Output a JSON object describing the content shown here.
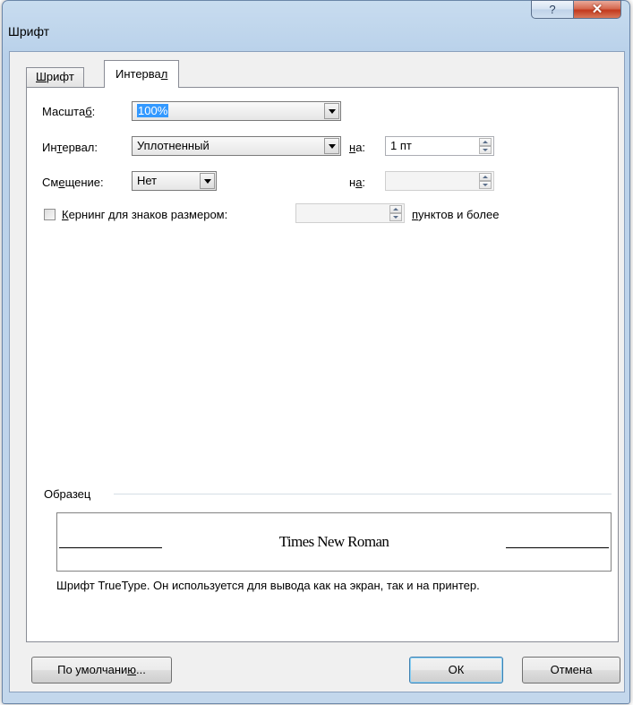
{
  "window": {
    "title": "Шрифт",
    "help_glyph": "?",
    "close_glyph": "✕"
  },
  "tabs": [
    {
      "pre": "",
      "mn": "Ш",
      "post": "рифт",
      "active": false
    },
    {
      "pre": "Интерва",
      "mn": "л",
      "post": "",
      "active": true
    }
  ],
  "scale": {
    "label_pre": "Масшта",
    "label_mn": "б",
    "label_post": ":",
    "value": "100%"
  },
  "spacing": {
    "label_pre": "Ин",
    "label_mn": "т",
    "label_post": "ервал:",
    "value": "Уплотненный",
    "by_mn": "н",
    "by_post": "а:",
    "by_value": "1 пт"
  },
  "position": {
    "label_pre": "См",
    "label_mn": "е",
    "label_post": "щение:",
    "value": "Нет",
    "by_pre": "н",
    "by_mn": "а",
    "by_post": ":",
    "by_value": ""
  },
  "kerning": {
    "checked": false,
    "label_mn": "К",
    "label_post": "ернинг для знаков размером:",
    "value": "",
    "suffix_mn": "п",
    "suffix_post": "унктов и более"
  },
  "preview": {
    "group_label": "Образец",
    "sample_text": "Times New Roman",
    "description": "Шрифт TrueType. Он используется для вывода как на экран, так и на принтер."
  },
  "buttons": {
    "default_pre": "По умолчани",
    "default_mn": "ю",
    "default_post": "...",
    "ok": "ОК",
    "cancel": "Отмена"
  }
}
